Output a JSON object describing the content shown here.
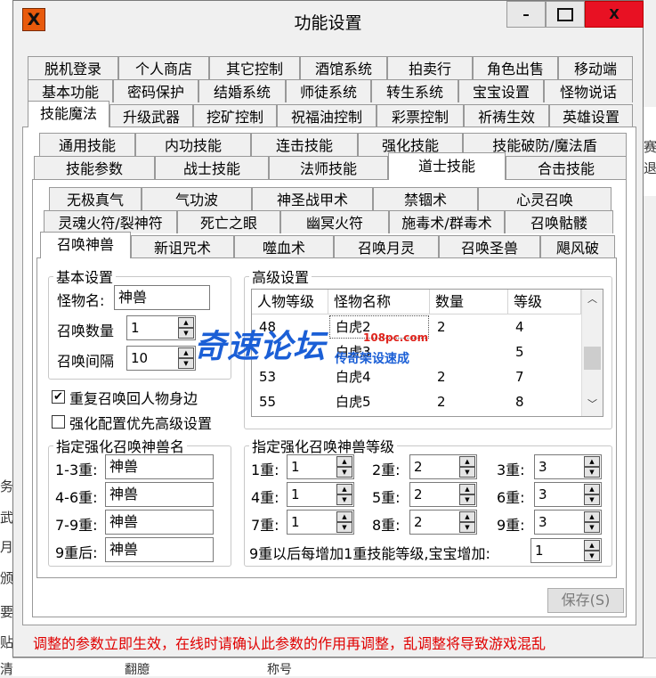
{
  "window": {
    "title": "功能设置",
    "app_icon_text": "X",
    "controls": {
      "minimize": "–",
      "close": "X"
    }
  },
  "background": {
    "left_fragments": [
      "务",
      "武",
      "月",
      "颁",
      "要",
      "贴",
      "清"
    ],
    "right_fragments": [
      "赛",
      "退"
    ],
    "bottom_fragments": [
      "翻臆",
      "称号"
    ]
  },
  "main_tabs": {
    "row1": [
      "脱机登录",
      "个人商店",
      "其它控制",
      "酒馆系统",
      "拍卖行",
      "角色出售",
      "移动端"
    ],
    "row2": [
      "基本功能",
      "密码保护",
      "结婚系统",
      "师徒系统",
      "转生系统",
      "宝宝设置",
      "怪物说话"
    ],
    "row3": [
      "技能魔法",
      "升级武器",
      "挖矿控制",
      "祝福油控制",
      "彩票控制",
      "祈祷生效",
      "英雄设置"
    ],
    "selected": "技能魔法"
  },
  "skill_tabs": {
    "row1": [
      "通用技能",
      "内功技能",
      "连击技能",
      "强化技能",
      "技能破防/魔法盾"
    ],
    "row2": [
      "技能参数",
      "战士技能",
      "法师技能",
      "道士技能",
      "合击技能"
    ],
    "selected": "道士技能"
  },
  "taoist_tabs": {
    "row1": [
      "无极真气",
      "气功波",
      "神圣战甲术",
      "禁锢术",
      "心灵召唤"
    ],
    "row2": [
      "灵魂火符/裂神符",
      "死亡之眼",
      "幽冥火符",
      "施毒术/群毒术",
      "召唤骷髅"
    ],
    "row3": [
      "召唤神兽",
      "新诅咒术",
      "噬血术",
      "召唤月灵",
      "召唤圣兽",
      "飓风破"
    ],
    "selected": "召唤神兽"
  },
  "basic": {
    "title": "基本设置",
    "monster_name_label": "怪物名:",
    "monster_name_value": "神兽",
    "summon_count_label": "召唤数量",
    "summon_count_value": "1",
    "summon_interval_label": "召唤间隔",
    "summon_interval_value": "10"
  },
  "checkboxes": [
    {
      "label": "重复召唤回人物身边",
      "checked": true
    },
    {
      "label": "强化配置优先高级设置",
      "checked": false
    }
  ],
  "enhanced_names": {
    "title": "指定强化召唤神兽名",
    "rows": [
      {
        "label": "1-3重:",
        "value": "神兽"
      },
      {
        "label": "4-6重:",
        "value": "神兽"
      },
      {
        "label": "7-9重:",
        "value": "神兽"
      },
      {
        "label": "9重后:",
        "value": "神兽"
      }
    ]
  },
  "advanced": {
    "title": "高级设置",
    "columns": [
      "人物等级",
      "怪物名称",
      "数量",
      "等级"
    ],
    "rows": [
      [
        "48",
        "白虎2",
        "2",
        "4"
      ],
      [
        "",
        "白虎3",
        "",
        "5"
      ],
      [
        "53",
        "白虎4",
        "2",
        "7"
      ],
      [
        "55",
        "白虎5",
        "2",
        "8"
      ]
    ],
    "scroll_up": "︿",
    "scroll_down": "﹀"
  },
  "enhanced_levels": {
    "title": "指定强化召唤神兽等级",
    "rows": [
      [
        {
          "label": "1重:",
          "value": "1"
        },
        {
          "label": "2重:",
          "value": "2"
        },
        {
          "label": "3重:",
          "value": "3"
        }
      ],
      [
        {
          "label": "4重:",
          "value": "1"
        },
        {
          "label": "5重:",
          "value": "2"
        },
        {
          "label": "6重:",
          "value": "3"
        }
      ],
      [
        {
          "label": "7重:",
          "value": "1"
        },
        {
          "label": "8重:",
          "value": "2"
        },
        {
          "label": "9重:",
          "value": "3"
        }
      ]
    ],
    "extra_label": "9重以后每增加1重技能等级,宝宝增加:",
    "extra_value": "1"
  },
  "save_button": "保存(S)",
  "warning": "调整的参数立即生效，在线时请确认此参数的作用再调整，乱调整将导致游戏混乱",
  "watermark": {
    "main": "奇速论坛",
    "url": "108pc.com",
    "sub": "传奇架设速成"
  },
  "colors": {
    "warning": "#e00000",
    "close_button": "#e81123",
    "watermark_blue": "#1b5fd6",
    "watermark_red": "#e0261f"
  }
}
